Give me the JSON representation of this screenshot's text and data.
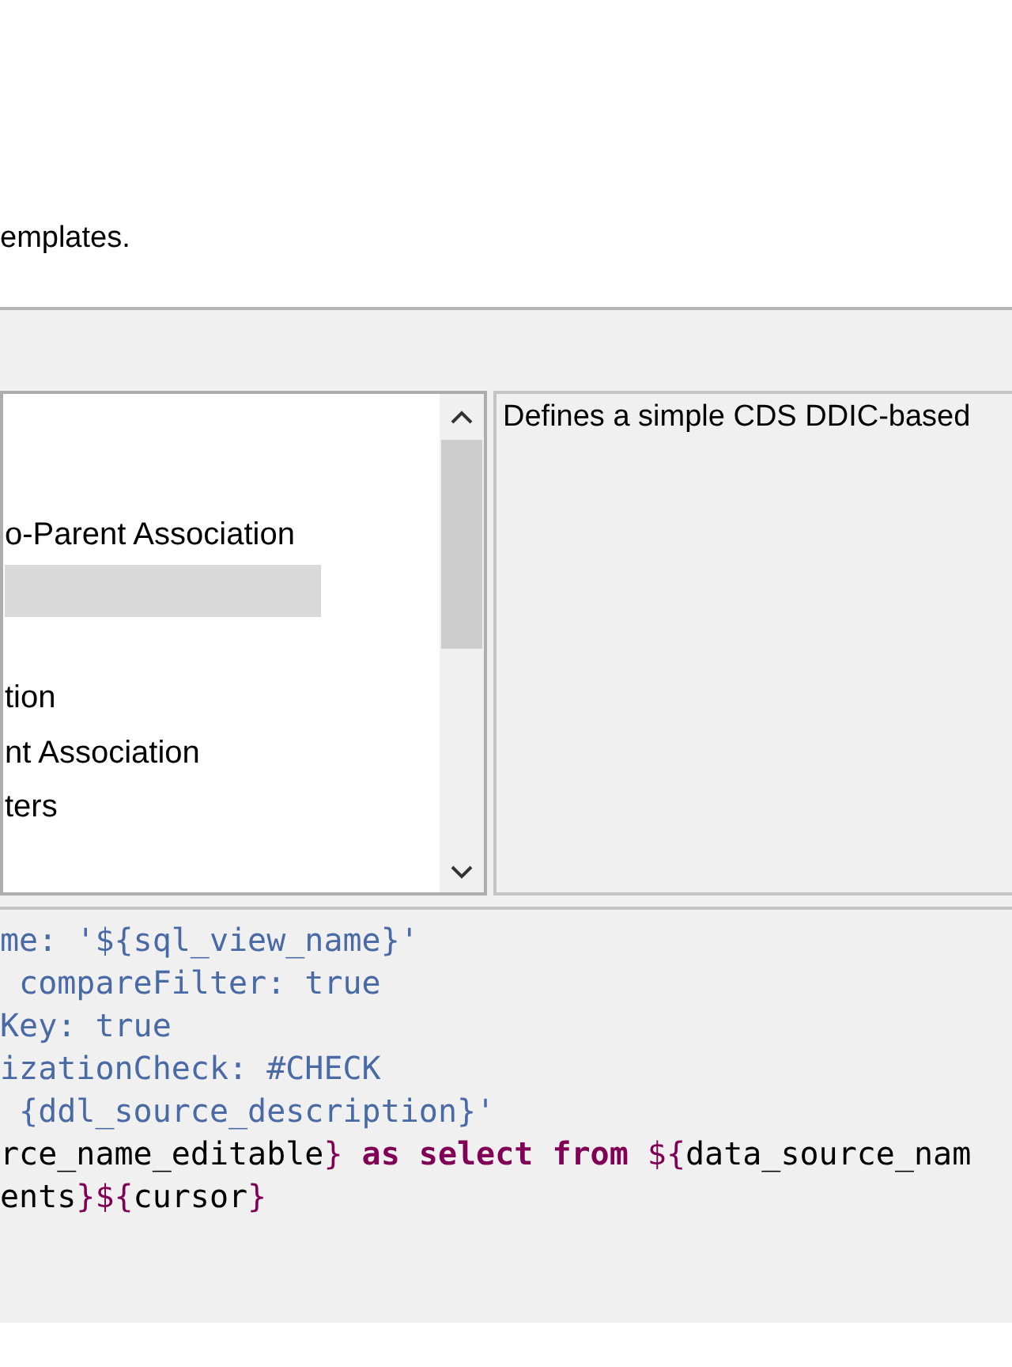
{
  "header": {
    "message": "emplates."
  },
  "template_list": {
    "items": [
      {
        "label": "o-Parent Association",
        "selected": false
      },
      {
        "selected": true
      },
      {
        "label": "tion",
        "selected": false
      },
      {
        "label": "nt Association",
        "selected": false
      },
      {
        "label": "ters",
        "selected": false
      }
    ]
  },
  "description": {
    "text": "Defines a simple CDS DDIC-based"
  },
  "preview": {
    "lines": [
      [
        {
          "kind": "annotation",
          "text": "me: '${sql_view_name}'"
        }
      ],
      [
        {
          "kind": "annotation",
          "text": " compareFilter: true"
        }
      ],
      [
        {
          "kind": "annotation",
          "text": "Key: true"
        }
      ],
      [
        {
          "kind": "annotation",
          "text": "izationCheck: #CHECK"
        }
      ],
      [
        {
          "kind": "annotation",
          "text": " {ddl_source_description}'"
        }
      ],
      [
        {
          "kind": "plain",
          "text": "rce_name_editable"
        },
        {
          "kind": "brace",
          "text": "}"
        },
        {
          "kind": "keyword",
          "text": " as select from "
        },
        {
          "kind": "brace",
          "text": "${"
        },
        {
          "kind": "plain",
          "text": "data_source_nam"
        }
      ],
      [
        {
          "kind": "plain",
          "text": "ents"
        },
        {
          "kind": "brace",
          "text": "}${"
        },
        {
          "kind": "plain",
          "text": "cursor"
        },
        {
          "kind": "brace",
          "text": "}"
        }
      ]
    ]
  }
}
